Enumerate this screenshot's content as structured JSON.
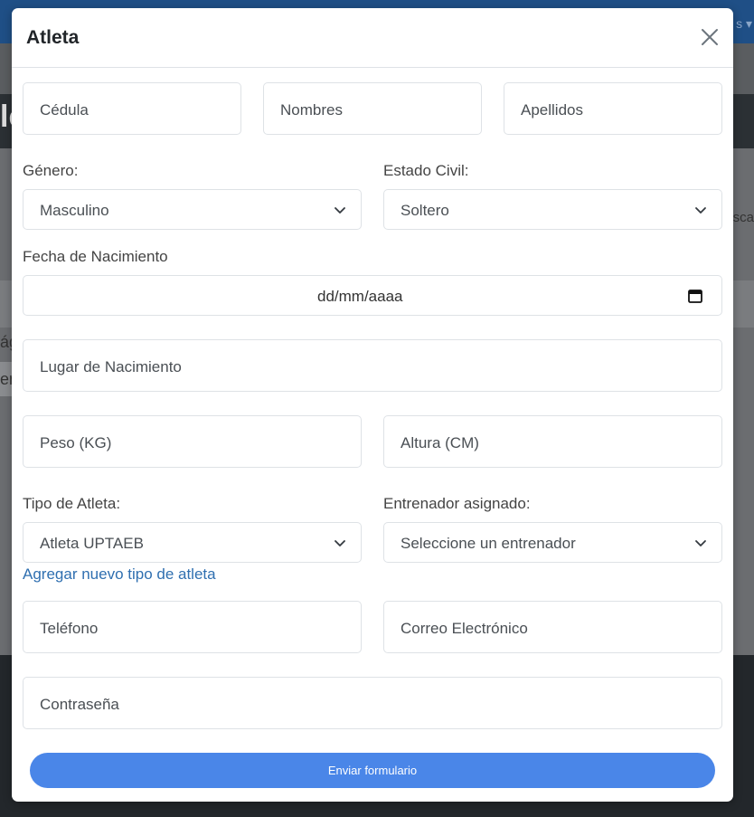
{
  "background": {
    "topbar_text": "s ▾",
    "band_text": "le",
    "side_text_1": "ág",
    "side_text_2": "en",
    "side_text_3": "usca"
  },
  "modal": {
    "title": "Atleta",
    "close_icon": "close-icon"
  },
  "form": {
    "cedula_placeholder": "Cédula",
    "nombres_placeholder": "Nombres",
    "apellidos_placeholder": "Apellidos",
    "genero_label": "Género:",
    "genero_value": "Masculino",
    "estado_civil_label": "Estado Civil:",
    "estado_civil_value": "Soltero",
    "fecha_label": "Fecha de Nacimiento",
    "fecha_placeholder": "dd/mm/aaaa",
    "lugar_placeholder": "Lugar de Nacimiento",
    "peso_placeholder": "Peso (KG)",
    "altura_placeholder": "Altura (CM)",
    "tipo_label": "Tipo de Atleta:",
    "tipo_value": "Atleta UPTAEB",
    "entrenador_label": "Entrenador asignado:",
    "entrenador_value": "Seleccione un entrenador",
    "agregar_link": "Agregar nuevo tipo de atleta",
    "telefono_placeholder": "Teléfono",
    "correo_placeholder": "Correo Electrónico",
    "contrasena_placeholder": "Contraseña",
    "submit_label": "Enviar formulario"
  },
  "colors": {
    "accent": "#4a86e8",
    "link": "#2f6fb0",
    "overlay": "#5a5d60"
  }
}
